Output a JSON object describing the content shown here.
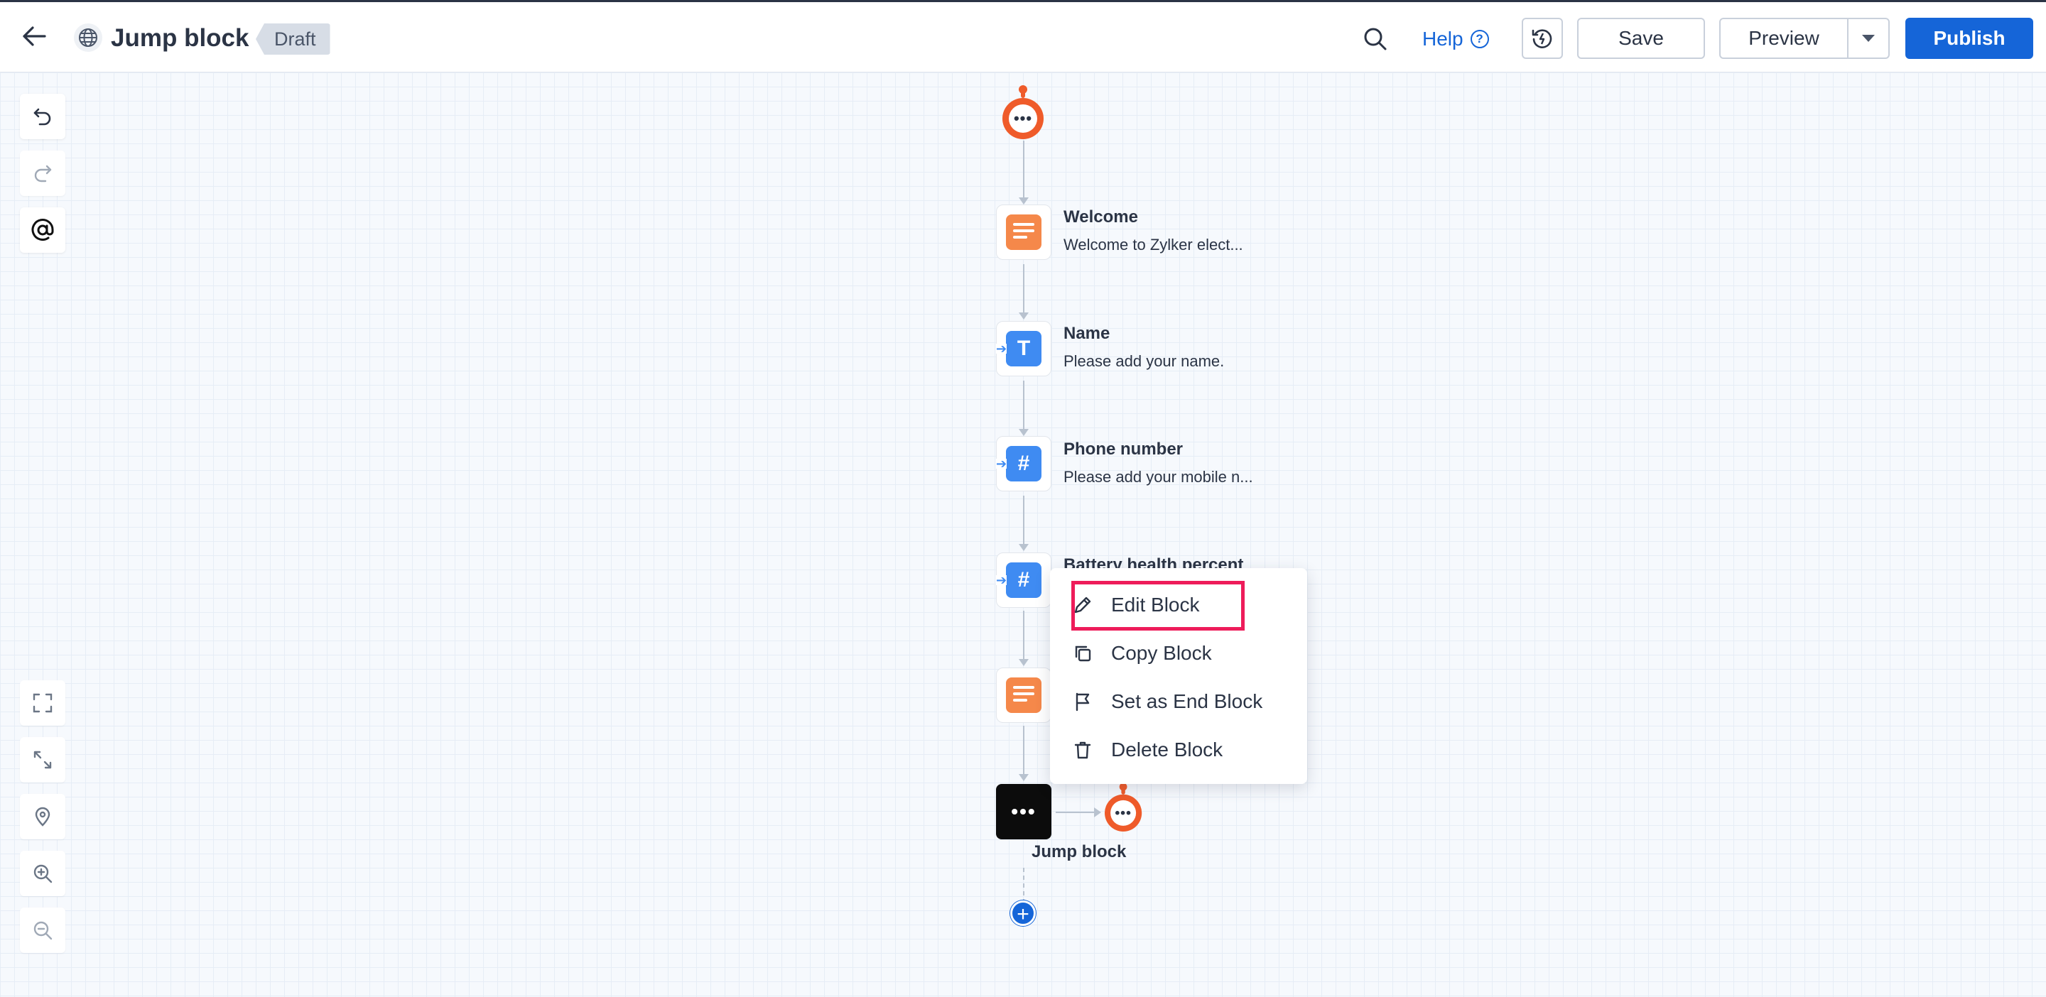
{
  "header": {
    "title": "Jump block",
    "status": "Draft",
    "help_label": "Help",
    "help_glyph": "?",
    "save_label": "Save",
    "preview_label": "Preview",
    "publish_label": "Publish"
  },
  "flow": {
    "nodes": [
      {
        "title": "Welcome",
        "subtitle": "Welcome to Zylker elect...",
        "icon": "message-icon"
      },
      {
        "title": "Name",
        "subtitle": "Please add your name.",
        "icon": "text-input-icon",
        "glyph": "T"
      },
      {
        "title": "Phone number",
        "subtitle": "Please add your mobile n...",
        "icon": "number-input-icon",
        "glyph": "#"
      },
      {
        "title": "Battery health percent",
        "subtitle": "",
        "icon": "number-input-icon",
        "glyph": "#"
      },
      {
        "title": "",
        "subtitle": "",
        "icon": "message-icon"
      }
    ],
    "jump_block_label": "Jump block",
    "jump_glyph": "•••",
    "bot_glyph": "•••",
    "add_glyph": "+"
  },
  "context_menu": {
    "items": [
      {
        "label": "Edit Block",
        "icon": "pencil-icon"
      },
      {
        "label": "Copy Block",
        "icon": "copy-icon"
      },
      {
        "label": "Set as End Block",
        "icon": "flag-icon"
      },
      {
        "label": "Delete Block",
        "icon": "trash-icon"
      }
    ],
    "highlighted_index": 0
  },
  "colors": {
    "primary": "#1565d8",
    "bot_orange": "#ef5b2a",
    "message_orange": "#f5884a",
    "input_blue": "#3f8bf2",
    "highlight_red": "#ee1c5a"
  }
}
